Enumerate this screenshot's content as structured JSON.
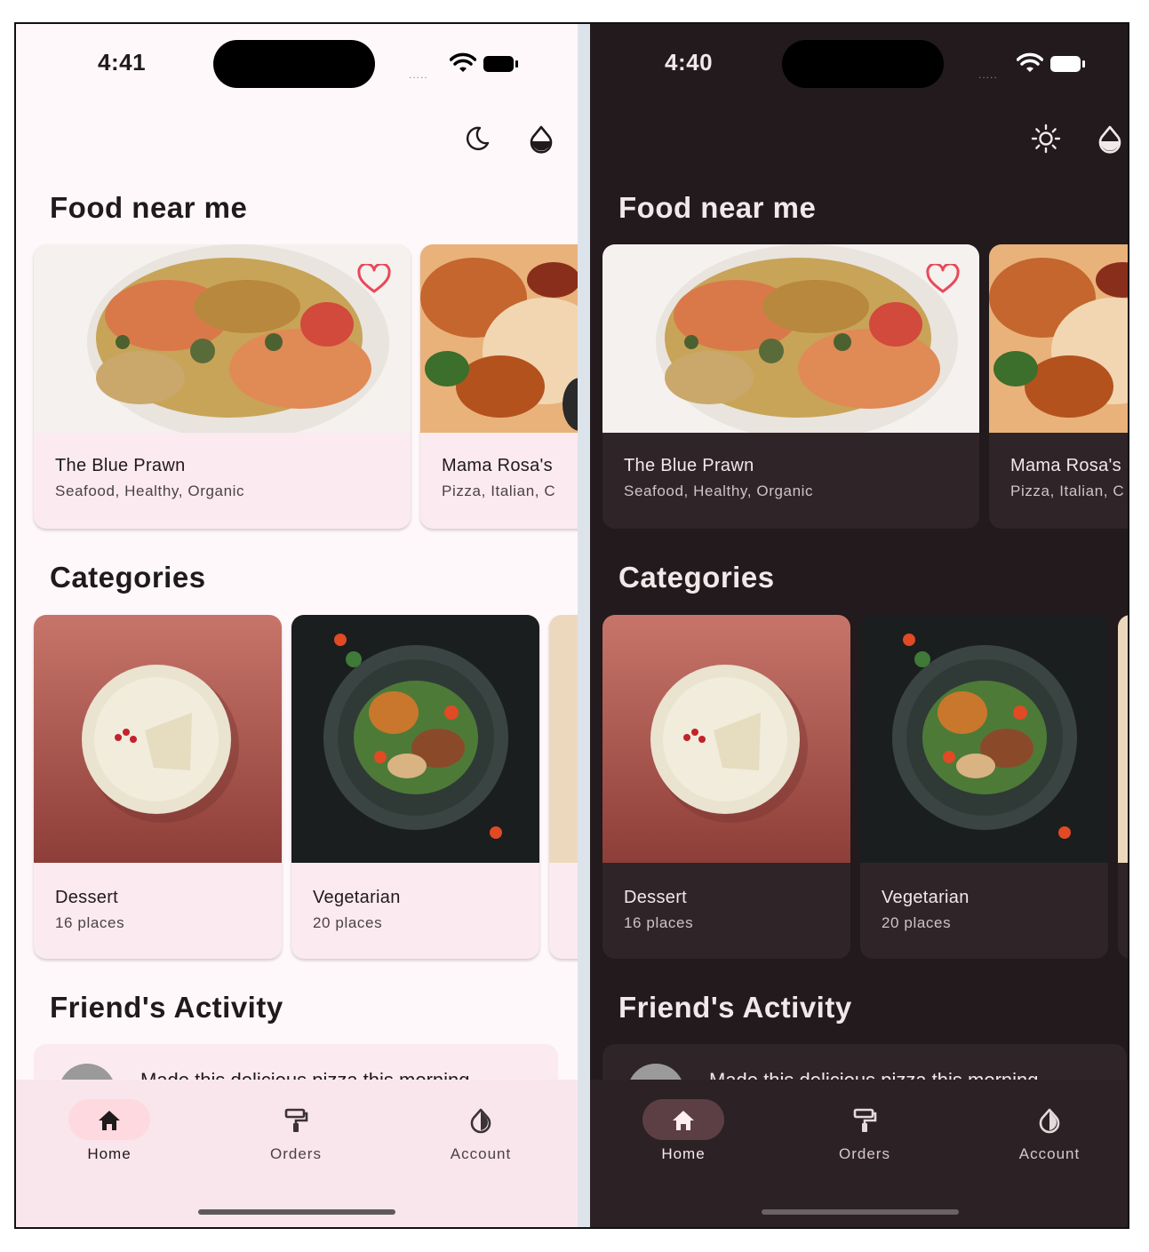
{
  "light": {
    "status": {
      "time": "4:41",
      "signal": "....."
    },
    "header": {
      "theme_icon": "moon-icon",
      "color_icon": "drop-icon"
    },
    "sections": {
      "food": "Food near me",
      "categories": "Categories",
      "activity": "Friend's Activity"
    },
    "restaurants": [
      {
        "name": "The Blue Prawn",
        "tags": "Seafood, Healthy, Organic"
      },
      {
        "name": "Mama Rosa's",
        "tags": "Pizza, Italian, C"
      }
    ],
    "categories": [
      {
        "name": "Dessert",
        "count": "16 places"
      },
      {
        "name": "Vegetarian",
        "count": "20 places"
      }
    ],
    "activity": {
      "text": "Made this delicious pizza this morning"
    },
    "nav": [
      {
        "label": "Home",
        "icon": "home-icon"
      },
      {
        "label": "Orders",
        "icon": "roller-icon"
      },
      {
        "label": "Account",
        "icon": "contrast-icon"
      }
    ]
  },
  "dark": {
    "status": {
      "time": "4:40",
      "signal": "....."
    },
    "header": {
      "theme_icon": "sun-icon",
      "color_icon": "drop-icon"
    },
    "sections": {
      "food": "Food near me",
      "categories": "Categories",
      "activity": "Friend's Activity"
    },
    "restaurants": [
      {
        "name": "The Blue Prawn",
        "tags": "Seafood, Healthy, Organic"
      },
      {
        "name": "Mama Rosa's",
        "tags": "Pizza, Italian, C"
      }
    ],
    "categories": [
      {
        "name": "Dessert",
        "count": "16 places"
      },
      {
        "name": "Vegetarian",
        "count": "20 places"
      }
    ],
    "activity": {
      "text": "Made this delicious pizza this morning"
    },
    "nav": [
      {
        "label": "Home",
        "icon": "home-icon"
      },
      {
        "label": "Orders",
        "icon": "roller-icon"
      },
      {
        "label": "Account",
        "icon": "contrast-icon"
      }
    ]
  },
  "colors": {
    "light_bg": "#fff8fa",
    "dark_bg": "#221a1c",
    "accent_heart": "#e84a5a",
    "light_nav_pill": "#ffd9e0",
    "dark_nav_pill": "#5c3f45"
  }
}
